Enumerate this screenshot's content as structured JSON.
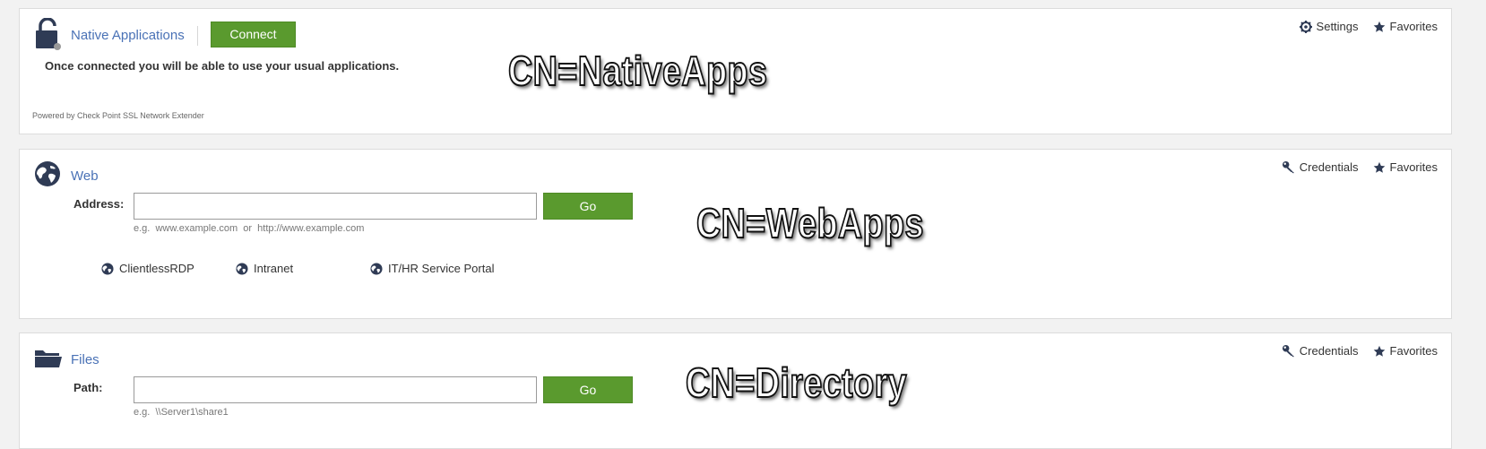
{
  "native_apps": {
    "title": "Native Applications",
    "connect_label": "Connect",
    "description": "Once connected you will be able to use your usual applications.",
    "powered_by": "Powered by Check Point SSL Network Extender",
    "settings_label": "Settings",
    "favorites_label": "Favorites",
    "icons": [
      "lock-icon",
      "gear-icon",
      "star-icon"
    ]
  },
  "web": {
    "title": "Web",
    "credentials_label": "Credentials",
    "favorites_label": "Favorites",
    "address_label": "Address:",
    "address_value": "",
    "go_label": "Go",
    "example": "e.g.  www.example.com  or  http://www.example.com",
    "bookmarks": [
      {
        "label": "ClientlessRDP"
      },
      {
        "label": "Intranet"
      },
      {
        "label": "IT/HR Service Portal"
      }
    ],
    "icons": [
      "globe-icon",
      "key-icon",
      "star-icon"
    ]
  },
  "files": {
    "title": "Files",
    "credentials_label": "Credentials",
    "favorites_label": "Favorites",
    "path_label": "Path:",
    "path_value": "",
    "go_label": "Go",
    "example": "e.g.  \\\\Server1\\share1",
    "icons": [
      "folder-icon",
      "key-icon",
      "star-icon"
    ]
  },
  "overlays": {
    "native": "CN=NativeApps",
    "web": "CN=WebApps",
    "files": "CN=Directory"
  },
  "colors": {
    "accent_green": "#5a9a2e",
    "link_blue": "#4a72b6",
    "icon_navy": "#2f3b55"
  }
}
